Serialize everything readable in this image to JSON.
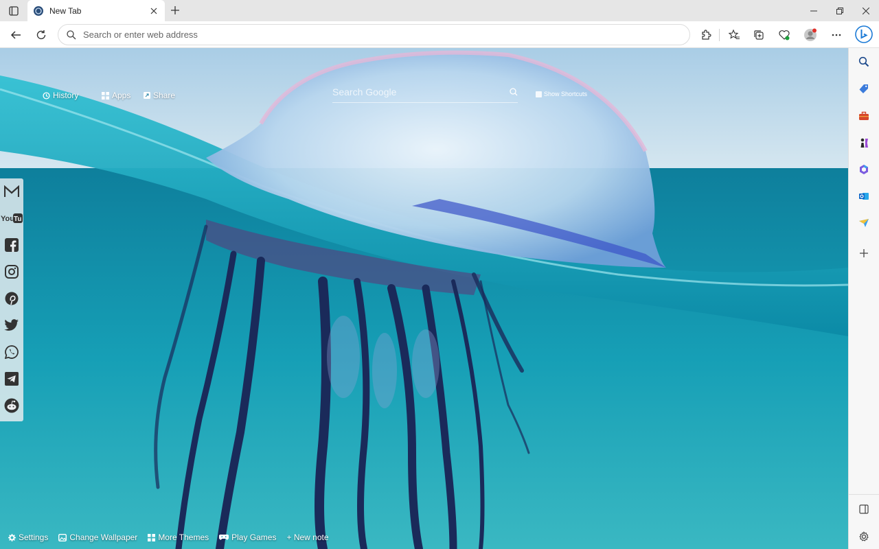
{
  "tab": {
    "title": "New Tab"
  },
  "toolbar": {
    "address_placeholder": "Search or enter web address"
  },
  "newtab": {
    "links": {
      "history": "History",
      "apps": "Apps",
      "share": "Share"
    },
    "search_placeholder": "Search Google",
    "show_shortcuts": "Show Shortcuts",
    "social": [
      "gmail-icon",
      "youtube-icon",
      "facebook-icon",
      "instagram-icon",
      "pinterest-icon",
      "twitter-icon",
      "whatsapp-icon",
      "telegram-icon",
      "reddit-icon"
    ],
    "bottom": {
      "settings": "Settings",
      "change_wallpaper": "Change Wallpaper",
      "more_themes": "More Themes",
      "play_games": "Play Games",
      "new_note": "+ New note"
    }
  },
  "colors": {
    "accent": "#0f6cbd",
    "water": "#139bb4",
    "sidebar": "#f7f7f7"
  }
}
